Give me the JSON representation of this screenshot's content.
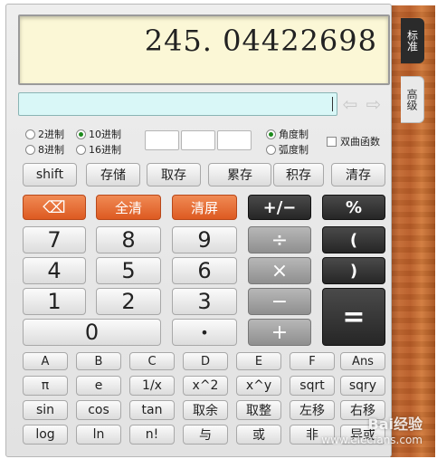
{
  "display": {
    "value": "245. 04422698"
  },
  "tabs": {
    "standard": "标准",
    "advanced": "高级"
  },
  "base_options": [
    {
      "label": "2进制",
      "selected": false
    },
    {
      "label": "10进制",
      "selected": true
    },
    {
      "label": "8进制",
      "selected": false
    },
    {
      "label": "16进制",
      "selected": false
    }
  ],
  "angle_options": [
    {
      "label": "角度制",
      "selected": true
    },
    {
      "label": "弧度制",
      "selected": false
    }
  ],
  "hyperbolic": {
    "label": "双曲函数",
    "checked": false
  },
  "memory_row": [
    "shift",
    "存储",
    "取存",
    "累存",
    "积存",
    "清存"
  ],
  "keys": {
    "backspace": "⌫",
    "clear_all": "全清",
    "clear_screen": "清屏",
    "plus_minus": "+/−",
    "percent": "%",
    "d7": "7",
    "d8": "8",
    "d9": "9",
    "divide": "÷",
    "lparen": "(",
    "d4": "4",
    "d5": "5",
    "d6": "6",
    "multiply": "×",
    "rparen": ")",
    "d1": "1",
    "d2": "2",
    "d3": "3",
    "minus": "−",
    "equals": "=",
    "d0": "0",
    "dot": "•",
    "plus": "+"
  },
  "hex_row": [
    "A",
    "B",
    "C",
    "D",
    "E",
    "F",
    "Ans"
  ],
  "fn_row1": [
    "π",
    "e",
    "1/x",
    "x^2",
    "x^y",
    "sqrt",
    "sqry"
  ],
  "fn_row2": [
    "sin",
    "cos",
    "tan",
    "取余",
    "取整",
    "左移",
    "右移"
  ],
  "fn_row3": [
    "log",
    "ln",
    "n!",
    "与",
    "或",
    "非",
    "异或"
  ],
  "watermark": {
    "title": "Bai经验",
    "url": "www.elecfans.com"
  }
}
